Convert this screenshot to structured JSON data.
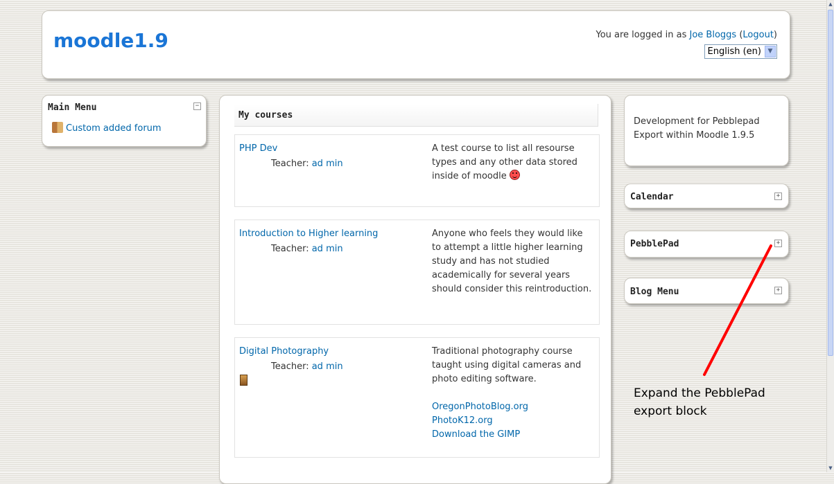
{
  "header": {
    "site_name": "moodle1.9",
    "login_prefix": "You are logged in as ",
    "user_name": "Joe Bloggs",
    "logout_open": " (",
    "logout_label": "Logout",
    "logout_close": ")",
    "language": "English (en)"
  },
  "main_menu": {
    "title": "Main Menu",
    "items": [
      {
        "label": "Custom added forum",
        "icon": "forum-icon"
      }
    ]
  },
  "my_courses": {
    "title": "My courses",
    "courses": [
      {
        "name": "PHP Dev",
        "teacher_label": "Teacher: ",
        "teacher": "ad min",
        "summary": "A test course to list all resourse types and any other data stored inside of moodle"
      },
      {
        "name": "Introduction to Higher learning",
        "teacher_label": "Teacher: ",
        "teacher": "ad min",
        "summary": "Anyone who feels they would like to attempt a little higher learning study and has not studied academically for several years should consider this reintroduction."
      },
      {
        "name": "Digital Photography",
        "teacher_label": "Teacher: ",
        "teacher": "ad min",
        "summary": "Traditional photography course taught using digital cameras and photo editing software.",
        "links": [
          "OregonPhotoBlog.org",
          "PhotoK12.org",
          "Download the GIMP"
        ]
      }
    ]
  },
  "right_blocks": {
    "description": "Development for Pebblepad Export within Moodle 1.9.5",
    "calendar": "Calendar",
    "pebblepad": "PebblePad",
    "blog_menu": "Blog Menu"
  },
  "annotation": {
    "text_line1": "Expand the PebblePad",
    "text_line2": "export block",
    "color": "#ff0000"
  }
}
